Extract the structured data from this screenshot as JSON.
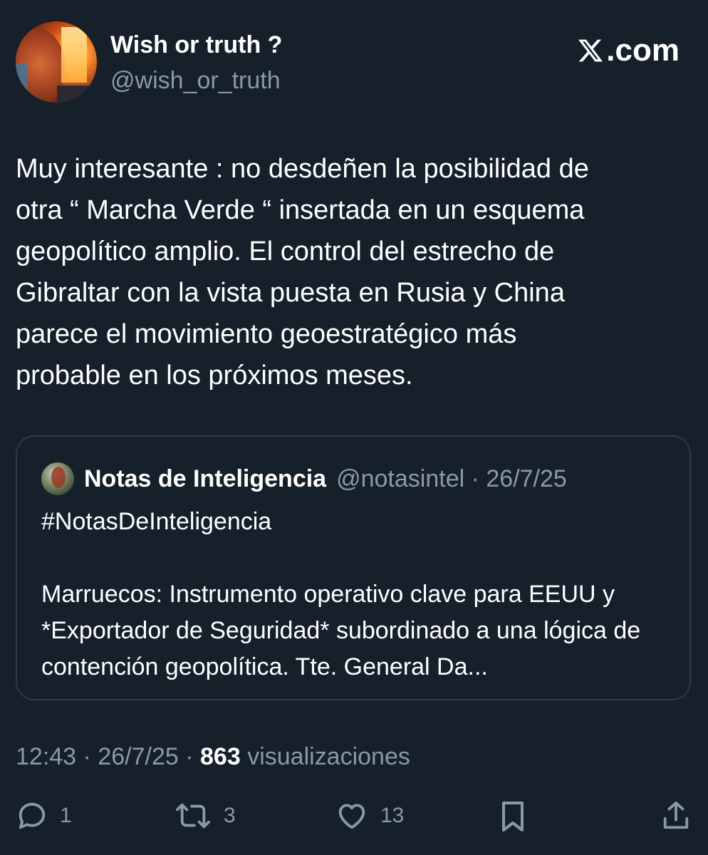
{
  "author": {
    "display_name": "Wish or truth ?",
    "handle": "@wish_or_truth"
  },
  "brand": {
    "label": ".com"
  },
  "tweet": {
    "text": "Muy interesante : no desdeñen la posibilidad de\notra “ Marcha Verde “ insertada en un esquema\ngeopolítico amplio.  El control del estrecho de\nGibraltar con la vista puesta en Rusia y China\nparece el movimiento geoestratégico más\nprobable en los próximos meses."
  },
  "quoted": {
    "name": "Notas de Inteligencia",
    "handle": "@notasintel",
    "date": "26/7/25",
    "hashtag": "#NotasDeInteligencia",
    "text": "Marruecos: Instrumento operativo clave para EEUU y *Exportador de Seguridad* subordinado a una lógica de contención geopolítica. Tte. General Da..."
  },
  "meta": {
    "time": "12:43",
    "date": "26/7/25",
    "views_count": "863",
    "views_label": "visualizaciones"
  },
  "actions": {
    "replies": "1",
    "reposts": "3",
    "likes": "13"
  },
  "colors": {
    "background": "#15202b",
    "text_primary": "#ffffff",
    "text_secondary": "#8b98a5",
    "border": "#2f3b47"
  }
}
